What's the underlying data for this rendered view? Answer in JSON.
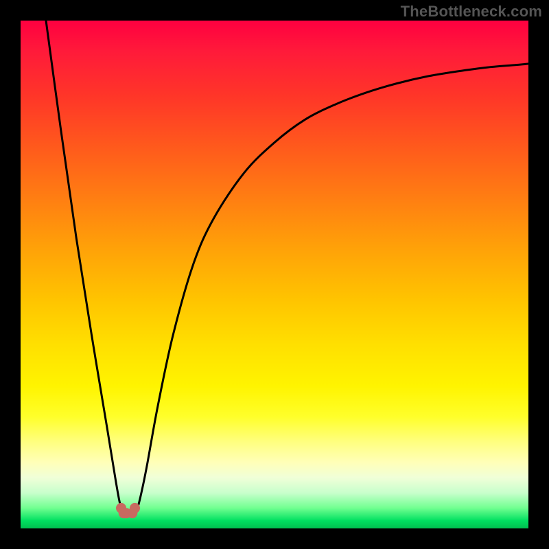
{
  "watermark": "TheBottleneck.com",
  "colors": {
    "page_bg": "#000000",
    "curve_stroke": "#000000",
    "marker_fill": "#c86a60",
    "gradient_top": "#ff0040",
    "gradient_bottom": "#00c050"
  },
  "chart_data": {
    "type": "line",
    "title": "",
    "xlabel": "",
    "ylabel": "",
    "xlim": [
      0,
      100
    ],
    "ylim": [
      0,
      100
    ],
    "grid": false,
    "legend": false,
    "annotations": [],
    "series": [
      {
        "name": "curve",
        "x": [
          5,
          8,
          11,
          14,
          17,
          18.8,
          19.8,
          20.8,
          22,
          23,
          24,
          25,
          27,
          30,
          34,
          38,
          44,
          50,
          56,
          62,
          68,
          74,
          80,
          86,
          92,
          98,
          100
        ],
        "values": [
          100,
          78,
          57,
          38,
          20,
          9,
          4,
          3,
          3,
          4,
          8,
          13,
          24,
          38,
          52,
          61,
          70,
          76,
          80.5,
          83.5,
          85.8,
          87.6,
          89,
          90,
          90.8,
          91.3,
          91.5
        ]
      }
    ],
    "markers": [
      {
        "x": 19.8,
        "y": 4
      },
      {
        "x": 20.3,
        "y": 3
      },
      {
        "x": 20.8,
        "y": 3
      },
      {
        "x": 22.0,
        "y": 3
      },
      {
        "x": 22.5,
        "y": 4
      }
    ]
  }
}
